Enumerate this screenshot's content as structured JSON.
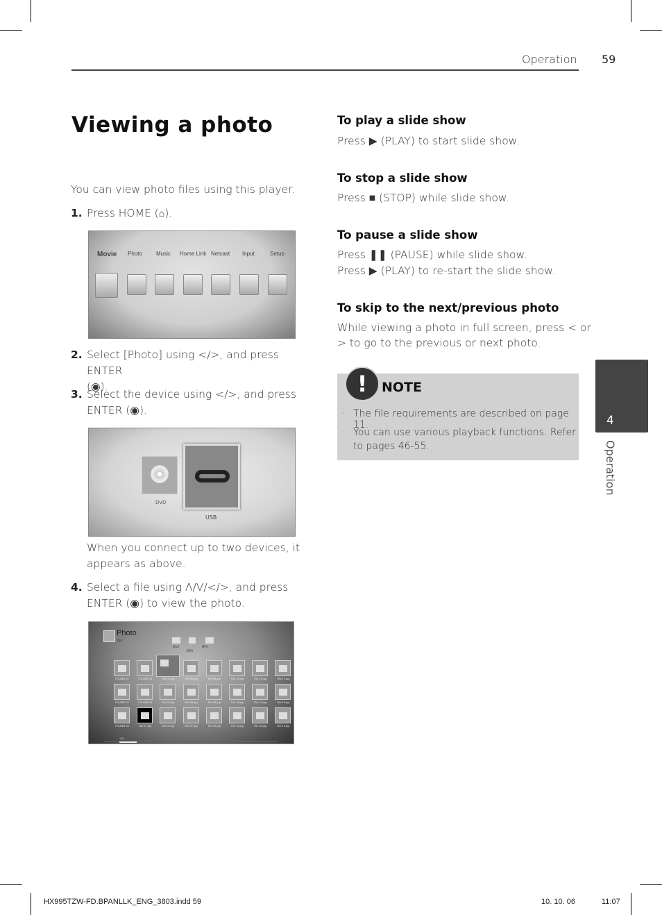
{
  "header": {
    "section": "Operation",
    "page_number": "59"
  },
  "title": "Viewing a photo",
  "intro": "You can view photo files using this player.",
  "steps": [
    {
      "number": "1.",
      "text": "Press HOME (",
      "text_end": ")."
    },
    {
      "number": "2.",
      "text": "Select [Photo] using </>, and press ENTER",
      "text2": "(",
      "text2_end": ")."
    },
    {
      "number": "3.",
      "text": "Select the device using </>, and press",
      "text2": "ENTER (",
      "text2_end": ")."
    },
    {
      "number": "4.",
      "text": "Select a file using Λ/V/</>, and press",
      "text2": "ENTER (",
      "text2_end": ") to view the photo."
    }
  ],
  "device_note": "When you connect up to two devices, it appears as above.",
  "home_menu": {
    "items": [
      "Movie",
      "Photo",
      "Music",
      "Home Link",
      "Netcast",
      "Input",
      "Setup"
    ]
  },
  "device_menu": {
    "devices": [
      "DVD",
      "USB"
    ]
  },
  "photo_menu": {
    "title": "Photo",
    "subtitle": "Disc",
    "folders": [
      "DivX",
      "JPEG",
      "MP3"
    ],
    "rows": [
      [
        "FOLDER 01",
        "FOLDER 04",
        "File 02.jpg",
        "File 05.jpg",
        "File 08.jpg",
        "File 11.jpg",
        "File 14.jpg",
        "File 17.jpg"
      ],
      [
        "FOLDER 02",
        "FOLDER 05",
        "File 03.jpg",
        "File 06.jpg",
        "File 09.jpg",
        "File 12.jpg",
        "File 15.jpg",
        "File 18.jpg"
      ],
      [
        "FOLDER 03",
        "File 01.jpg",
        "File 04.jpg",
        "File 07.jpg",
        "File 10.jpg",
        "File 13.jpg",
        "File 16.jpg",
        "File 19.jpg"
      ]
    ],
    "page": "1/01"
  },
  "sections": [
    {
      "title": "To play a slide show",
      "lines": [
        "Press ▶ (PLAY) to start slide show."
      ]
    },
    {
      "title": "To stop a slide show",
      "lines": [
        "Press ■ (STOP) while slide show."
      ]
    },
    {
      "title": "To pause a slide show",
      "lines": [
        "Press ❚❚ (PAUSE) while slide show.",
        "Press ▶ (PLAY) to re-start the slide show."
      ]
    },
    {
      "title": "To skip to the next/previous photo",
      "lines": [
        "While viewing a photo in full screen, press < or",
        "> to go to the previous or next photo."
      ]
    }
  ],
  "note": {
    "title": "NOTE",
    "bullets": [
      "The file requirements are described on page 11.",
      "You can use various playback functions. Refer to pages 46-55."
    ]
  },
  "side_tab": {
    "number": "4",
    "label": "Operation"
  },
  "footer": {
    "file": "HX995TZW-FD.BPANLLK_ENG_3803.indd   59",
    "date": "10. 10. 06",
    "time": "11:07"
  }
}
